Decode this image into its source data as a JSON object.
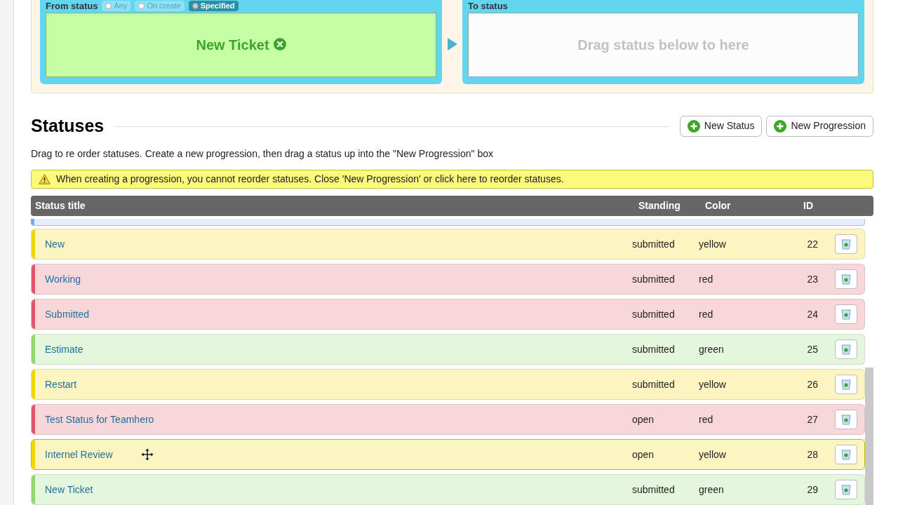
{
  "progression": {
    "from": {
      "label": "From status",
      "options": [
        {
          "label": "Any",
          "selected": false
        },
        {
          "label": "On create",
          "selected": false
        },
        {
          "label": "Specified",
          "selected": true
        }
      ],
      "value": "New Ticket"
    },
    "to": {
      "label": "To status",
      "placeholder": "Drag status below to here"
    }
  },
  "statuses": {
    "title": "Statuses",
    "buttons": [
      "New Status",
      "New Progression"
    ],
    "hint": "Drag to re order statuses. Create a new progression, then drag a status up into the \"New Progression\" box",
    "warning": "When creating a progression, you cannot reorder statuses. Close 'New Progression' or click here to reorder statuses.",
    "columns": [
      "Status title",
      "Standing",
      "Color",
      "ID"
    ],
    "partial_row": {
      "color": "#7aa7f0"
    },
    "rows": [
      {
        "title": "New",
        "standing": "submitted",
        "color_name": "yellow",
        "id": "22",
        "color": "#f2d600",
        "dragging": false
      },
      {
        "title": "Working",
        "standing": "submitted",
        "color_name": "red",
        "id": "23",
        "color": "#e0566a",
        "dragging": false
      },
      {
        "title": "Submitted",
        "standing": "submitted",
        "color_name": "red",
        "id": "24",
        "color": "#e0566a",
        "dragging": false
      },
      {
        "title": "Estimate",
        "standing": "submitted",
        "color_name": "green",
        "id": "25",
        "color": "#8fd96b",
        "dragging": false
      },
      {
        "title": "Restart",
        "standing": "submitted",
        "color_name": "yellow",
        "id": "26",
        "color": "#f2d600",
        "dragging": false
      },
      {
        "title": "Test Status for Teamhero",
        "standing": "open",
        "color_name": "red",
        "id": "27",
        "color": "#e0566a",
        "dragging": false
      },
      {
        "title": "Internel Review",
        "standing": "open",
        "color_name": "yellow",
        "id": "28",
        "color": "#f2d600",
        "dragging": true
      },
      {
        "title": "New Ticket",
        "standing": "submitted",
        "color_name": "green",
        "id": "29",
        "color": "#8fd96b",
        "dragging": false
      }
    ]
  }
}
